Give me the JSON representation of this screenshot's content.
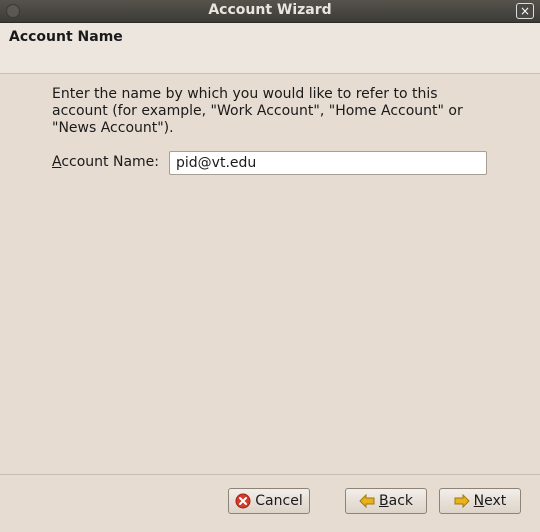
{
  "window": {
    "title": "Account Wizard",
    "close_symbol": "×"
  },
  "header": {
    "title": "Account Name"
  },
  "content": {
    "description": "Enter the name by which you would like to refer to this account (for example, \"Work Account\", \"Home Account\" or \"News Account\").",
    "field_label_mnemonic": "A",
    "field_label_rest": "ccount Name:",
    "field_value": "pid@vt.edu"
  },
  "buttons": {
    "cancel": "Cancel",
    "back_mnemonic": "B",
    "back_rest": "ack",
    "next_mnemonic": "N",
    "next_rest": "ext"
  },
  "icons": {
    "cancel": "cancel-x-icon",
    "back": "back-arrow-icon",
    "next": "next-arrow-icon"
  },
  "colors": {
    "titlebar": "#3c3b37",
    "background": "#e6dcd2",
    "cancel_icon": "#d43b2a",
    "arrow_icon": "#e8b21c"
  }
}
